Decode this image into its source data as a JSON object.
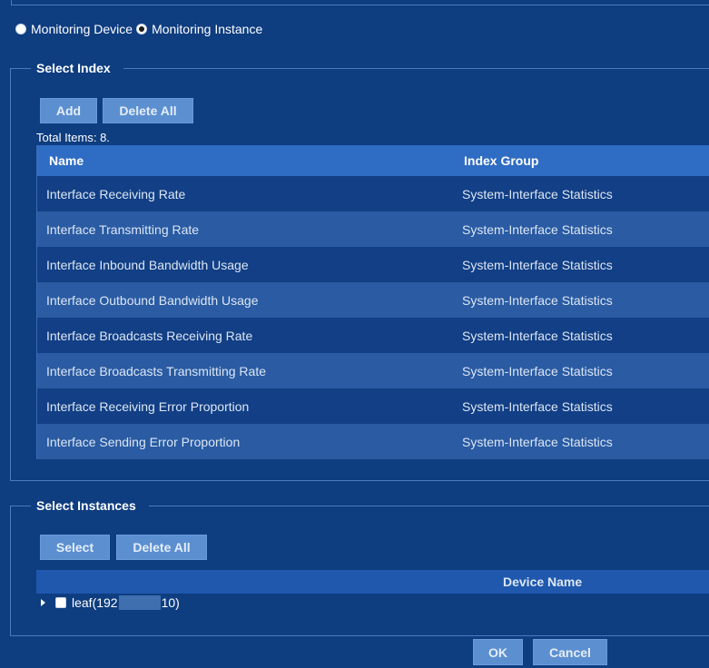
{
  "mode": {
    "options": [
      "Monitoring Device",
      "Monitoring Instance"
    ],
    "selected": "Monitoring Instance"
  },
  "select_index": {
    "legend": "Select Index",
    "add_label": "Add",
    "delete_all_label": "Delete All",
    "total": "Total Items: 8.",
    "columns": [
      "Name",
      "Index Group"
    ],
    "rows": [
      [
        "Interface Receiving Rate",
        "System-Interface Statistics"
      ],
      [
        "Interface Transmitting Rate",
        "System-Interface Statistics"
      ],
      [
        "Interface Inbound Bandwidth Usage",
        "System-Interface Statistics"
      ],
      [
        "Interface Outbound Bandwidth Usage",
        "System-Interface Statistics"
      ],
      [
        "Interface Broadcasts Receiving Rate",
        "System-Interface Statistics"
      ],
      [
        "Interface Broadcasts Transmitting Rate",
        "System-Interface Statistics"
      ],
      [
        "Interface Receiving Error Proportion",
        "System-Interface Statistics"
      ],
      [
        "Interface Sending Error Proportion",
        "System-Interface Statistics"
      ]
    ]
  },
  "select_instances": {
    "legend": "Select Instances",
    "select_label": "Select",
    "delete_all_label": "Delete All",
    "column": "Device Name",
    "tree_item": {
      "prefix": "leaf(192",
      "suffix": "10)"
    }
  },
  "footer": {
    "ok_label": "OK",
    "cancel_label": "Cancel"
  },
  "colors": {
    "background": "#0e3d80",
    "header": "#2f6cc3",
    "button": "#5b8fd0"
  }
}
